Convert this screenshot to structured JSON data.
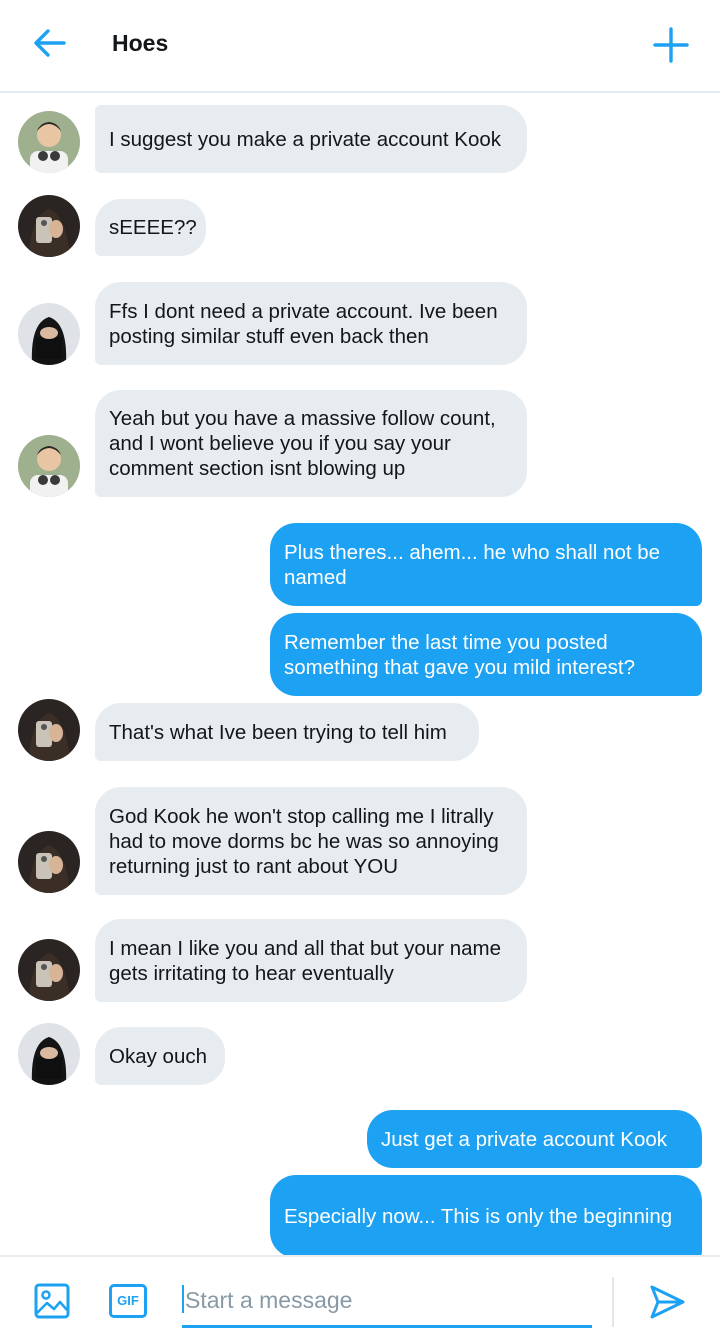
{
  "header": {
    "title": "Hoes"
  },
  "messages": [
    {
      "dir": "in",
      "avatar": "man",
      "text": "I suggest you make a private account Kook"
    },
    {
      "dir": "in",
      "avatar": "woman",
      "text": "sEEEE??"
    },
    {
      "dir": "in",
      "avatar": "dark",
      "text": "Ffs I dont need a private account. Ive been posting similar stuff even back then"
    },
    {
      "dir": "in",
      "avatar": "man",
      "text": "Yeah but you have a massive follow count, and I wont believe you if you say your comment section isnt blowing up"
    },
    {
      "dir": "out",
      "text": "Plus theres... ahem... he who shall not be named"
    },
    {
      "dir": "out",
      "text": "Remember the last time you posted something that gave you mild interest?"
    },
    {
      "dir": "in",
      "avatar": "woman",
      "text": "That's what Ive been trying to tell him"
    },
    {
      "dir": "in",
      "avatar": "woman",
      "text": "God Kook he won't stop calling me I litrally had to move dorms bc he was so annoying returning just to rant about YOU"
    },
    {
      "dir": "in",
      "avatar": "woman",
      "text": "I mean I like you and all that but your name gets irritating to hear eventually"
    },
    {
      "dir": "in",
      "avatar": "dark",
      "text": "Okay ouch"
    },
    {
      "dir": "out",
      "text": "Just get a private account Kook"
    },
    {
      "dir": "out",
      "text": "Especially now... This is only the beginning"
    }
  ],
  "composer": {
    "placeholder": "Start a message",
    "gif_label": "GIF"
  },
  "colors": {
    "accent": "#1da1f2",
    "incoming": "#e6ecf0"
  }
}
